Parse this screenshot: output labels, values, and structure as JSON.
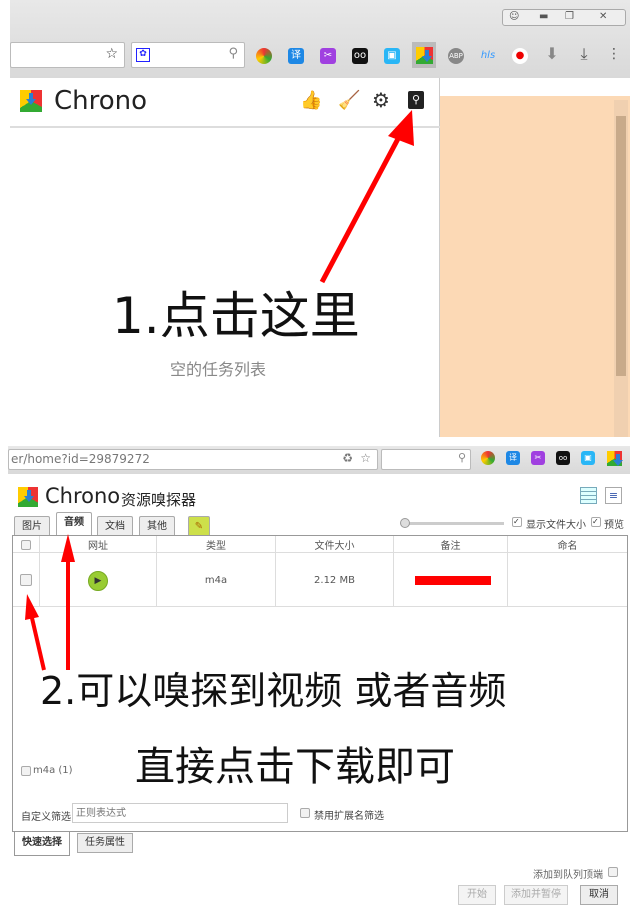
{
  "top": {
    "popup_title": "Chrono",
    "empty_text": "空的任务列表",
    "annotation": "1.点击这里",
    "toolbar_icons": [
      "like-icon",
      "broom-icon",
      "gear-icon",
      "sniffer-icon"
    ],
    "extension_icons": [
      "chrome-icon",
      "translate-icon",
      "scissors-icon",
      "tampermonkey-icon",
      "screenshot-icon",
      "chrono-icon",
      "abp-icon",
      "hls-icon",
      "record-icon",
      "download-arrow-icon",
      "download-icon",
      "menu-icon"
    ],
    "peach": "#fcd9b5"
  },
  "bottom": {
    "url": "er/home?id=29879272",
    "title": "Chrono",
    "subtitle": "资源嗅探器",
    "tabs": [
      "图片",
      "音频",
      "文档",
      "其他"
    ],
    "active_tab": "音频",
    "show_size_label": "显示文件大小",
    "preview_label": "预览",
    "columns": [
      "网址",
      "类型",
      "文件大小",
      "备注",
      "命名"
    ],
    "rows": [
      {
        "type": "m4a",
        "size": "2.12 MB"
      }
    ],
    "filter_type": "m4a (1)",
    "custom_filter_label": "自定义筛选",
    "regex_placeholder": "正则表达式",
    "disable_ext_label": "禁用扩展名筛选",
    "bottom_tabs": [
      "快速选择",
      "任务属性"
    ],
    "add_to_top_label": "添加到队列顶端",
    "buttons": {
      "start": "开始",
      "add_pause": "添加并暂停",
      "cancel": "取消"
    },
    "annotation1": "2.可以嗅探到视频 或者音频",
    "annotation2": "直接点击下载即可"
  },
  "colors": {
    "arrow": "#ff0000",
    "play": "#9c3"
  }
}
